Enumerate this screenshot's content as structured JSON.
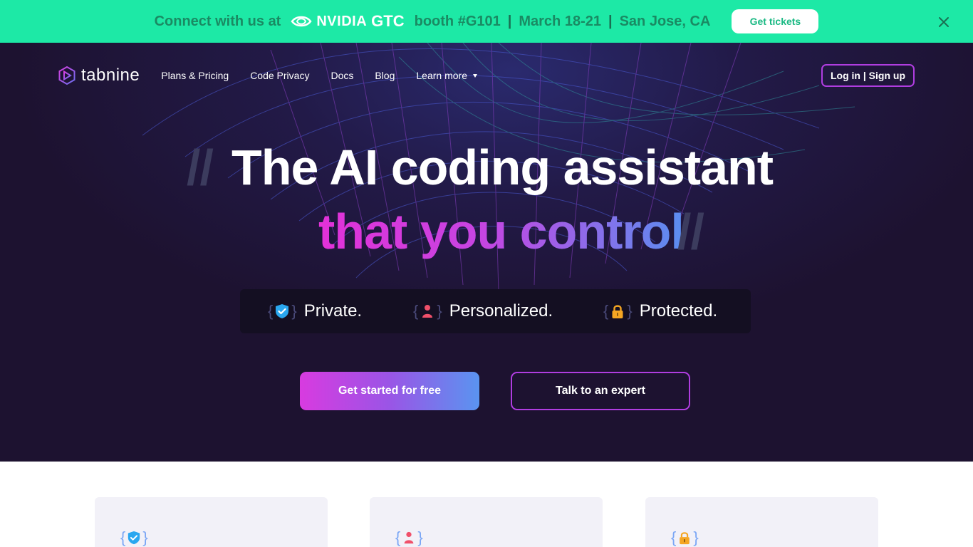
{
  "banner": {
    "prefix": "Connect with us at",
    "nvidia_word": "NVIDIA",
    "event": "GTC",
    "booth": "booth #G101",
    "separator": "|",
    "dates": "March 18-21",
    "location": "San Jose, CA",
    "cta_label": "Get tickets",
    "bg_color": "#1de9a6"
  },
  "nav": {
    "logo_text": "tabnine",
    "links": [
      "Plans & Pricing",
      "Code Privacy",
      "Docs",
      "Blog"
    ],
    "learn_more": "Learn more",
    "login_label": "Log in | Sign up"
  },
  "hero": {
    "slashes": "//",
    "line1": "The AI coding assistant",
    "line2": "that you control",
    "pills": [
      {
        "label": "Private.",
        "icon": "shield-check-icon"
      },
      {
        "label": "Personalized.",
        "icon": "person-icon"
      },
      {
        "label": "Protected.",
        "icon": "lock-icon"
      }
    ],
    "brace_open": "{",
    "brace_close": "}",
    "cta_primary": "Get started for free",
    "cta_secondary": "Talk to an expert"
  },
  "colors": {
    "accent_purple": "#b03de0",
    "gradient_start": "#e231d8",
    "gradient_end": "#5a94f0",
    "hero_bg": "#1d1230"
  }
}
